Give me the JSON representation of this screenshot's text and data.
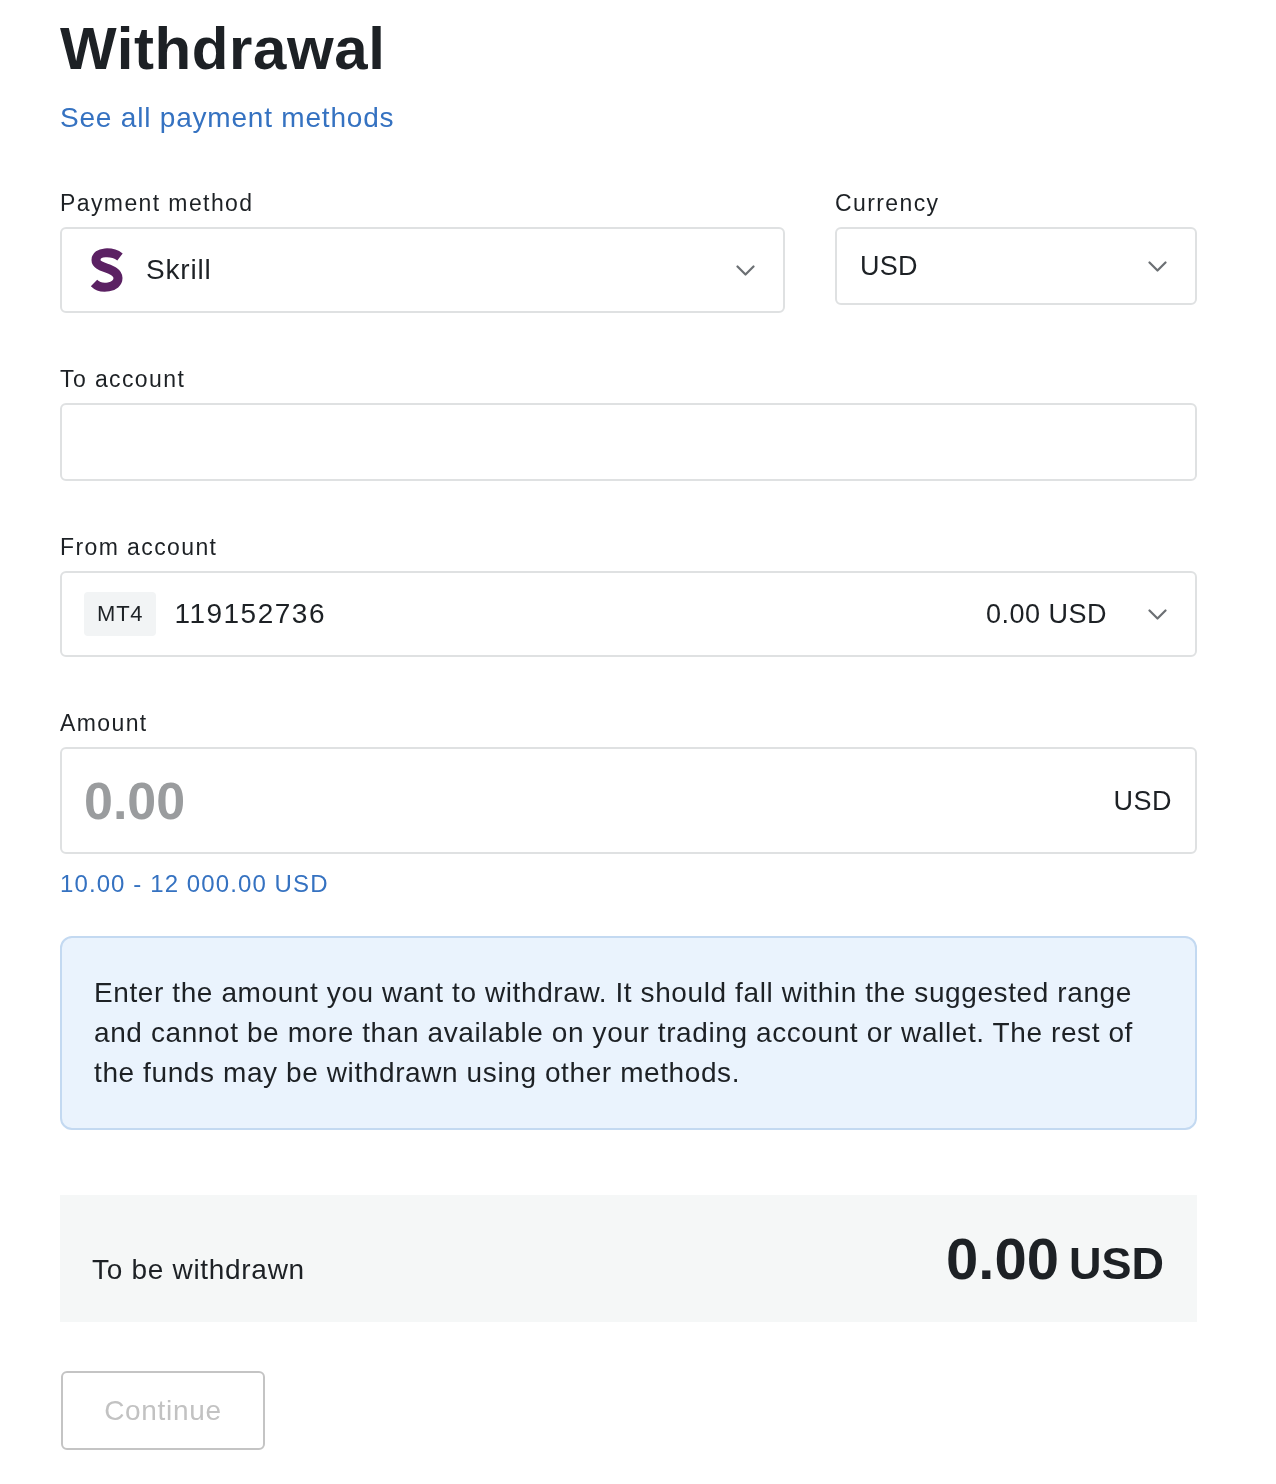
{
  "header": {
    "title": "Withdrawal",
    "link": "See all payment methods"
  },
  "form": {
    "payment_method": {
      "label": "Payment method",
      "value": "Skrill"
    },
    "currency": {
      "label": "Currency",
      "value": "USD"
    },
    "to_account": {
      "label": "To account"
    },
    "from_account": {
      "label": "From account",
      "platform": "MT4",
      "number": "119152736",
      "balance": "0.00 USD"
    },
    "amount": {
      "label": "Amount",
      "placeholder": "0.00",
      "currency": "USD",
      "range": "10.00 - 12 000.00 USD"
    }
  },
  "info": {
    "text": "Enter the amount you want to withdraw. It should fall within the suggested range and cannot be more than available on your trading account or wallet. The rest of the funds may be withdrawn using other methods."
  },
  "summary": {
    "label": "To be withdrawn",
    "amount": "0.00",
    "currency": "USD"
  },
  "buttons": [
    {
      "label": "Continue",
      "disabled": true
    }
  ]
}
